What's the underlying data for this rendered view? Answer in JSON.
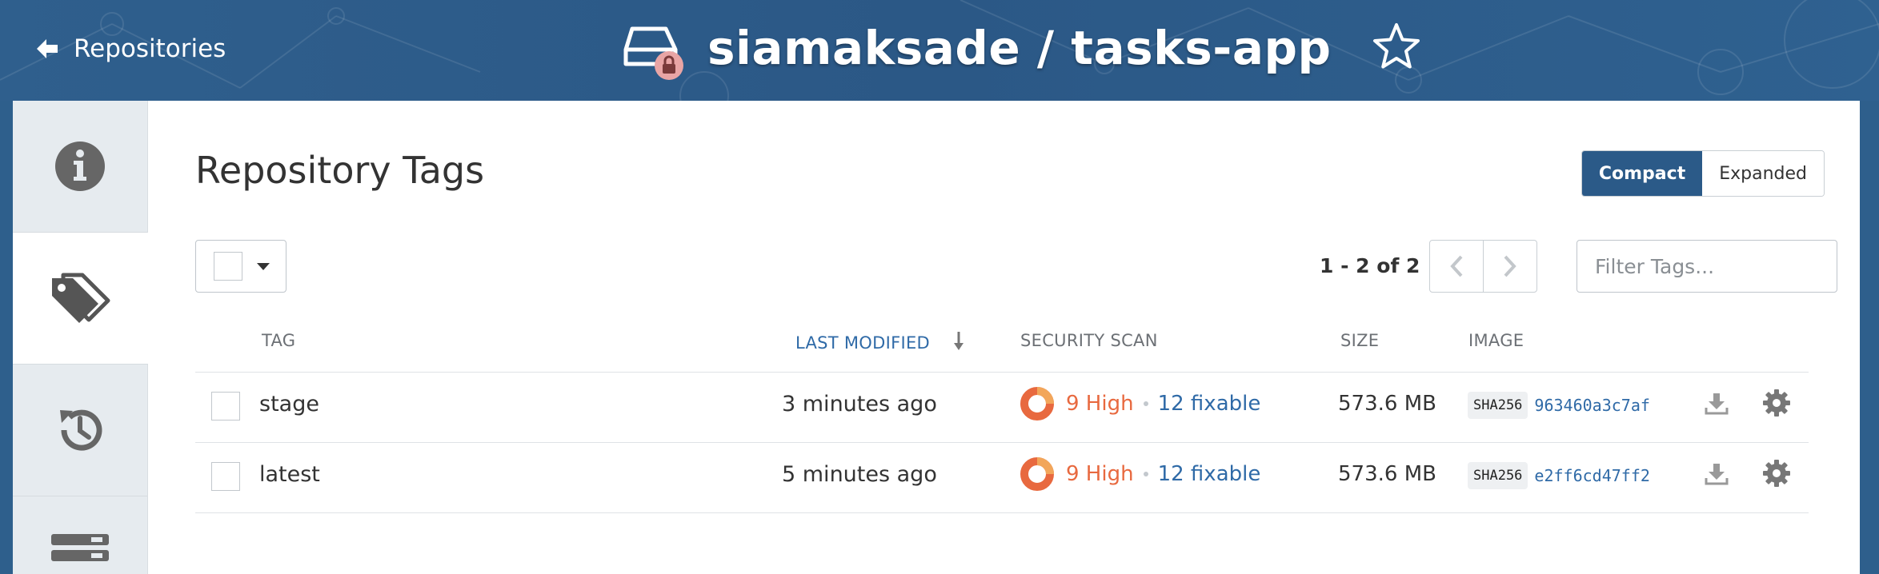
{
  "header": {
    "back_label": "Repositories",
    "repo_name": "siamaksade / tasks-app"
  },
  "sidebar": {
    "items": [
      {
        "name": "info-icon"
      },
      {
        "name": "tags-icon",
        "active": true
      },
      {
        "name": "history-icon"
      },
      {
        "name": "builds-icon"
      }
    ]
  },
  "main": {
    "title": "Repository Tags",
    "view_toggle": {
      "compact": "Compact",
      "expanded": "Expanded",
      "selected": "Compact"
    },
    "pagination": {
      "count_label": "1 - 2 of 2"
    },
    "filter": {
      "placeholder": "Filter Tags..."
    },
    "columns": {
      "tag": "TAG",
      "last_modified": "LAST MODIFIED",
      "security_scan": "SECURITY SCAN",
      "size": "SIZE",
      "image": "IMAGE"
    },
    "rows": [
      {
        "tag": "stage",
        "last_modified": "3 minutes ago",
        "high": "9 High",
        "fixable": "12 fixable",
        "size": "573.6 MB",
        "sha": "SHA256",
        "digest": "963460a3c7af"
      },
      {
        "tag": "latest",
        "last_modified": "5 minutes ago",
        "high": "9 High",
        "fixable": "12 fixable",
        "size": "573.6 MB",
        "sha": "SHA256",
        "digest": "e2ff6cd47ff2"
      }
    ]
  },
  "colors": {
    "header_bg": "#2f5f8d",
    "accent": "#2b5a88",
    "link": "#2f6aa7",
    "high_severity": "#e8693f"
  }
}
